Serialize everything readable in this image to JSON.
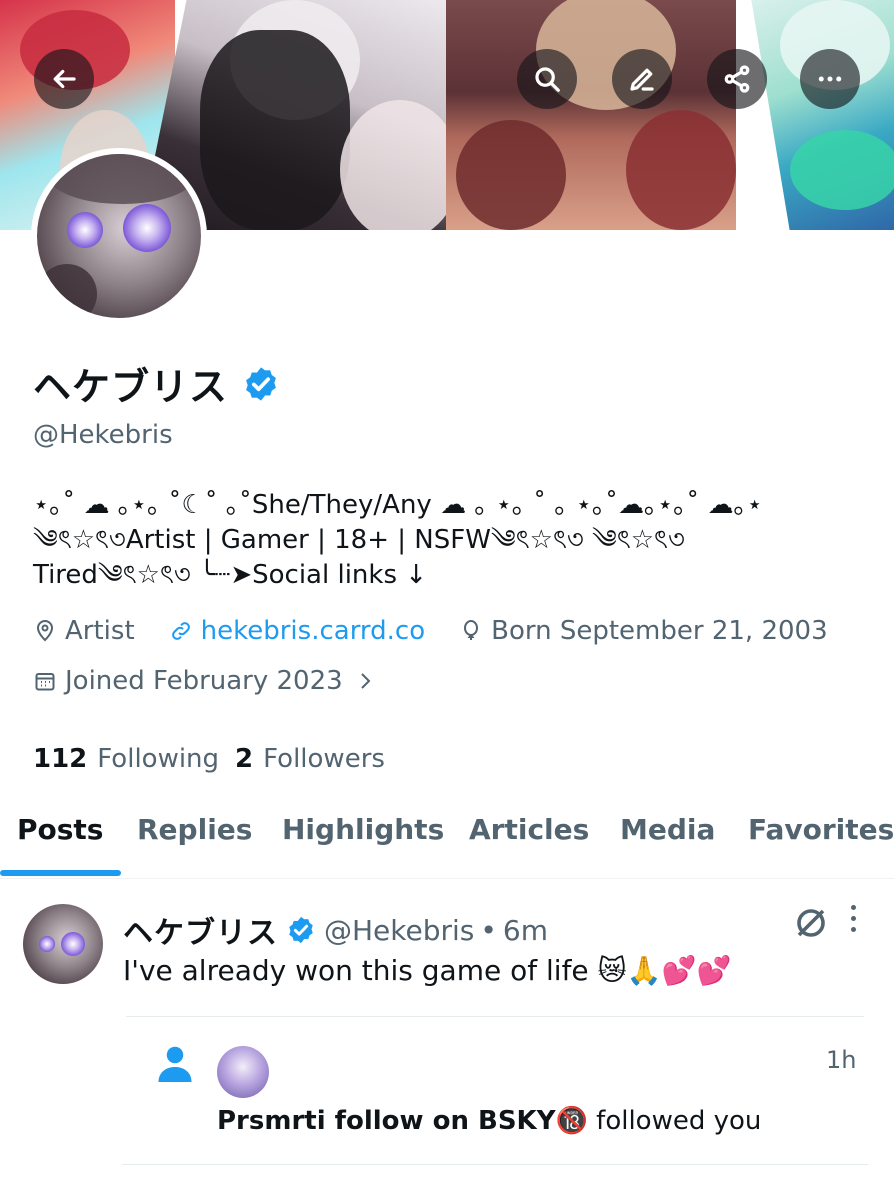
{
  "profile": {
    "display_name": "ヘケブリス",
    "handle": "@Hekebris",
    "bio_lines": [
      "⋆｡˚ ☁︎ ｡⋆｡ ˚☾˚ ｡˚She/They/Any ☁︎ ｡ ⋆｡ ˚ ｡ ⋆｡˚☁︎｡⋆｡˚ ☁︎｡⋆",
      "༄ৎ☆ৎ৩Artist | Gamer | 18+ | NSFW༄ৎ☆ৎ৩ ༄ৎ☆ৎ৩",
      "Tired༄ৎ☆ৎ৩ ╰┈➤Social links ↓"
    ],
    "category": "Artist",
    "website": "hekebris.carrd.co",
    "birthday": "Born September 21, 2003",
    "joined": "Joined February 2023",
    "following_count": "112",
    "following_label": "Following",
    "followers_count": "2",
    "followers_label": "Followers",
    "accent_color": "#1d9bf0"
  },
  "banner": {
    "icons": [
      "back-arrow-icon",
      "search-icon",
      "edit-icon",
      "share-icon",
      "more-horizontal-icon"
    ]
  },
  "tabs": [
    {
      "label": "Posts",
      "active": true
    },
    {
      "label": "Replies",
      "active": false
    },
    {
      "label": "Highlights",
      "active": false
    },
    {
      "label": "Articles",
      "active": false
    },
    {
      "label": "Media",
      "active": false
    },
    {
      "label": "Favorites",
      "active": false
    }
  ],
  "post": {
    "author_name": "ヘケブリス",
    "author_handle": "@Hekebris",
    "separator": "•",
    "time": "6m",
    "text": "I've already won this game of life 😿🙏💕💕"
  },
  "notification": {
    "user": "Prsmrti follow on BSKY🔞",
    "action": "followed you",
    "time": "1h"
  }
}
